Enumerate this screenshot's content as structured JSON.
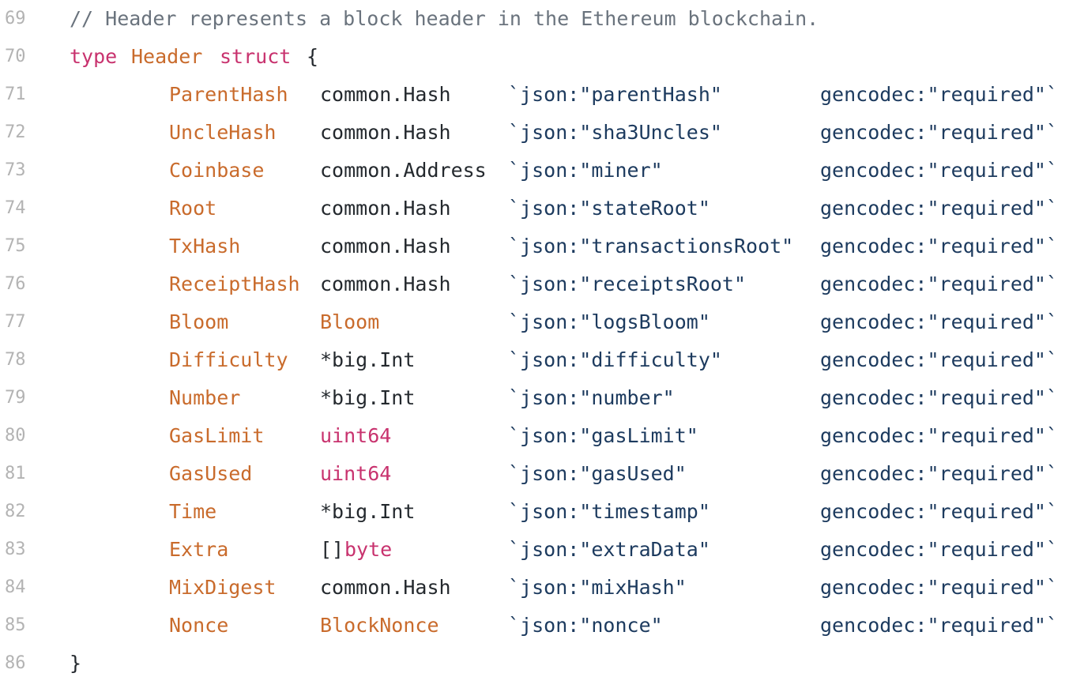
{
  "code": {
    "comment_line": {
      "number": "69",
      "text": "// Header represents a block header in the Ethereum blockchain."
    },
    "type_line": {
      "number": "70",
      "keyword_type": "type",
      "name": "Header",
      "keyword_struct": "struct",
      "open_brace": "{"
    },
    "fields": [
      {
        "number": "71",
        "name": "ParentHash",
        "type_prefix": "",
        "type": "common.Hash",
        "type_is_keyword": false,
        "json_tag": "`json:\"parentHash\"",
        "gencodec_tag": "gencodec:\"required\"`"
      },
      {
        "number": "72",
        "name": "UncleHash",
        "type_prefix": "",
        "type": "common.Hash",
        "type_is_keyword": false,
        "json_tag": "`json:\"sha3Uncles\"",
        "gencodec_tag": "gencodec:\"required\"`"
      },
      {
        "number": "73",
        "name": "Coinbase",
        "type_prefix": "",
        "type": "common.Address",
        "type_is_keyword": false,
        "json_tag": "`json:\"miner\"",
        "gencodec_tag": "gencodec:\"required\"`"
      },
      {
        "number": "74",
        "name": "Root",
        "type_prefix": "",
        "type": "common.Hash",
        "type_is_keyword": false,
        "json_tag": "`json:\"stateRoot\"",
        "gencodec_tag": "gencodec:\"required\"`"
      },
      {
        "number": "75",
        "name": "TxHash",
        "type_prefix": "",
        "type": "common.Hash",
        "type_is_keyword": false,
        "json_tag": "`json:\"transactionsRoot\"",
        "gencodec_tag": "gencodec:\"required\"`"
      },
      {
        "number": "76",
        "name": "ReceiptHash",
        "type_prefix": "",
        "type": "common.Hash",
        "type_is_keyword": false,
        "json_tag": "`json:\"receiptsRoot\"",
        "gencodec_tag": "gencodec:\"required\"`"
      },
      {
        "number": "77",
        "name": "Bloom",
        "type_prefix": "",
        "type": "Bloom",
        "type_is_keyword": false,
        "type_colored": true,
        "json_tag": "`json:\"logsBloom\"",
        "gencodec_tag": "gencodec:\"required\"`"
      },
      {
        "number": "78",
        "name": "Difficulty",
        "type_prefix": "",
        "type": "*big.Int",
        "type_is_keyword": false,
        "json_tag": "`json:\"difficulty\"",
        "gencodec_tag": "gencodec:\"required\"`"
      },
      {
        "number": "79",
        "name": "Number",
        "type_prefix": "",
        "type": "*big.Int",
        "type_is_keyword": false,
        "json_tag": "`json:\"number\"",
        "gencodec_tag": "gencodec:\"required\"`"
      },
      {
        "number": "80",
        "name": "GasLimit",
        "type_prefix": "",
        "type": "uint64",
        "type_is_keyword": true,
        "json_tag": "`json:\"gasLimit\"",
        "gencodec_tag": "gencodec:\"required\"`"
      },
      {
        "number": "81",
        "name": "GasUsed",
        "type_prefix": "",
        "type": "uint64",
        "type_is_keyword": true,
        "json_tag": "`json:\"gasUsed\"",
        "gencodec_tag": "gencodec:\"required\"`"
      },
      {
        "number": "82",
        "name": "Time",
        "type_prefix": "",
        "type": "*big.Int",
        "type_is_keyword": false,
        "json_tag": "`json:\"timestamp\"",
        "gencodec_tag": "gencodec:\"required\"`"
      },
      {
        "number": "83",
        "name": "Extra",
        "type_prefix": "[]",
        "type": "byte",
        "type_is_keyword": true,
        "json_tag": "`json:\"extraData\"",
        "gencodec_tag": "gencodec:\"required\"`"
      },
      {
        "number": "84",
        "name": "MixDigest",
        "type_prefix": "",
        "type": "common.Hash",
        "type_is_keyword": false,
        "json_tag": "`json:\"mixHash\"",
        "gencodec_tag": "gencodec:\"required\"`"
      },
      {
        "number": "85",
        "name": "Nonce",
        "type_prefix": "",
        "type": "BlockNonce",
        "type_is_keyword": false,
        "type_colored": true,
        "json_tag": "`json:\"nonce\"",
        "gencodec_tag": "gencodec:\"required\"`"
      }
    ],
    "close_line": {
      "number": "86",
      "close_brace": "}"
    }
  },
  "colors": {
    "keyword": "#c8326e",
    "identifier": "#c96b2c",
    "comment": "#6a737d",
    "line_number": "#b3b3b3",
    "tag": "#1c3a5e"
  }
}
